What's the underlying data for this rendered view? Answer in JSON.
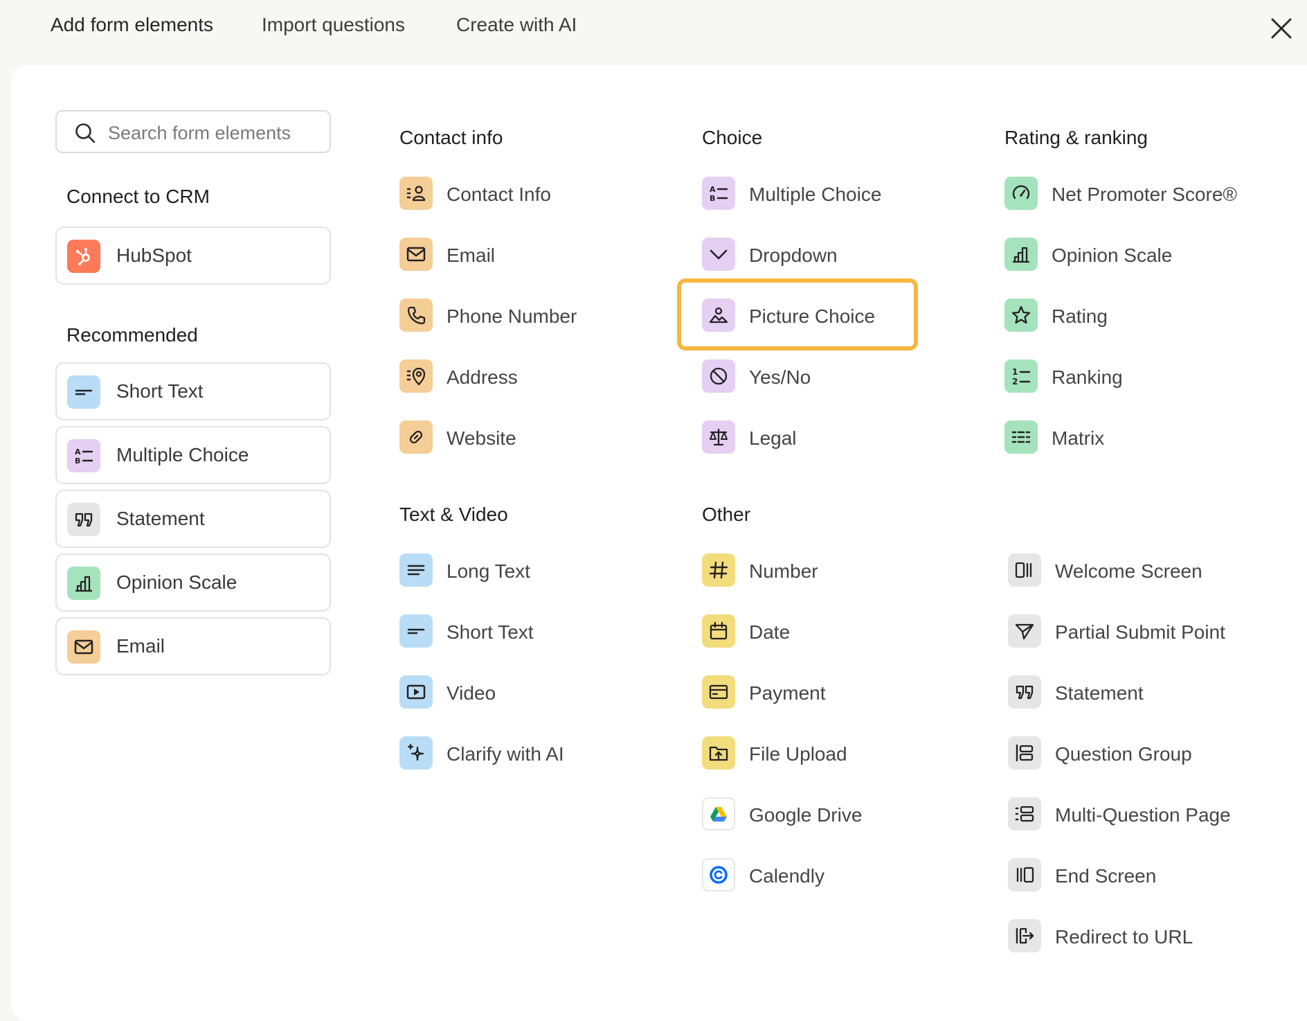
{
  "tabs": [
    {
      "label": "Add form elements"
    },
    {
      "label": "Import questions"
    },
    {
      "label": "Create with AI"
    }
  ],
  "search": {
    "placeholder": "Search form elements"
  },
  "sidebar": {
    "crm_heading": "Connect to CRM",
    "crm_items": [
      {
        "label": "HubSpot",
        "icon": "hubspot-logo-icon"
      }
    ],
    "recommended_heading": "Recommended",
    "recommended_items": [
      {
        "label": "Short Text",
        "icon": "short-text-icon"
      },
      {
        "label": "Multiple Choice",
        "icon": "multiple-choice-icon"
      },
      {
        "label": "Statement",
        "icon": "quote-icon"
      },
      {
        "label": "Opinion Scale",
        "icon": "bar-chart-icon"
      },
      {
        "label": "Email",
        "icon": "envelope-icon"
      }
    ]
  },
  "contact_info": {
    "heading": "Contact info",
    "items": [
      {
        "label": "Contact Info",
        "icon": "contact-card-icon"
      },
      {
        "label": "Email",
        "icon": "envelope-icon"
      },
      {
        "label": "Phone Number",
        "icon": "phone-icon"
      },
      {
        "label": "Address",
        "icon": "location-pin-icon"
      },
      {
        "label": "Website",
        "icon": "link-icon"
      }
    ]
  },
  "choice": {
    "heading": "Choice",
    "items": [
      {
        "label": "Multiple Choice",
        "icon": "multiple-choice-icon"
      },
      {
        "label": "Dropdown",
        "icon": "chevron-down-icon"
      },
      {
        "label": "Picture Choice",
        "icon": "picture-icon"
      },
      {
        "label": "Yes/No",
        "icon": "yes-no-icon"
      },
      {
        "label": "Legal",
        "icon": "scales-icon"
      }
    ]
  },
  "rating": {
    "heading": "Rating & ranking",
    "items": [
      {
        "label": "Net Promoter Score®",
        "icon": "gauge-icon"
      },
      {
        "label": "Opinion Scale",
        "icon": "bar-chart-icon"
      },
      {
        "label": "Rating",
        "icon": "star-icon"
      },
      {
        "label": "Ranking",
        "icon": "numbered-list-icon"
      },
      {
        "label": "Matrix",
        "icon": "grid-icon"
      }
    ]
  },
  "text_video": {
    "heading": "Text & Video",
    "items": [
      {
        "label": "Long Text",
        "icon": "long-text-icon"
      },
      {
        "label": "Short Text",
        "icon": "short-text-icon"
      },
      {
        "label": "Video",
        "icon": "video-play-icon"
      },
      {
        "label": "Clarify with AI",
        "icon": "sparkle-icon"
      }
    ]
  },
  "other": {
    "heading": "Other",
    "items": [
      {
        "label": "Number",
        "icon": "hash-icon"
      },
      {
        "label": "Date",
        "icon": "calendar-icon"
      },
      {
        "label": "Payment",
        "icon": "credit-card-icon"
      },
      {
        "label": "File Upload",
        "icon": "folder-upload-icon"
      },
      {
        "label": "Google Drive",
        "icon": "google-drive-icon"
      },
      {
        "label": "Calendly",
        "icon": "calendly-icon"
      }
    ]
  },
  "structure": {
    "items": [
      {
        "label": "Welcome Screen",
        "icon": "welcome-screen-icon"
      },
      {
        "label": "Partial Submit Point",
        "icon": "send-icon"
      },
      {
        "label": "Statement",
        "icon": "quote-icon"
      },
      {
        "label": "Question Group",
        "icon": "question-group-icon"
      },
      {
        "label": "Multi-Question Page",
        "icon": "multi-question-icon"
      },
      {
        "label": "End Screen",
        "icon": "end-screen-icon"
      },
      {
        "label": "Redirect to URL",
        "icon": "redirect-icon"
      }
    ]
  },
  "colors": {
    "highlight": "#f8b63f",
    "contact": "#f5cd96",
    "choice": "#e5cff2",
    "rating": "#a5e3bd",
    "text": "#b9ddf6",
    "other": "#f2dc7c",
    "structure": "#e6e6e6",
    "hubspot": "#ff7a59"
  }
}
